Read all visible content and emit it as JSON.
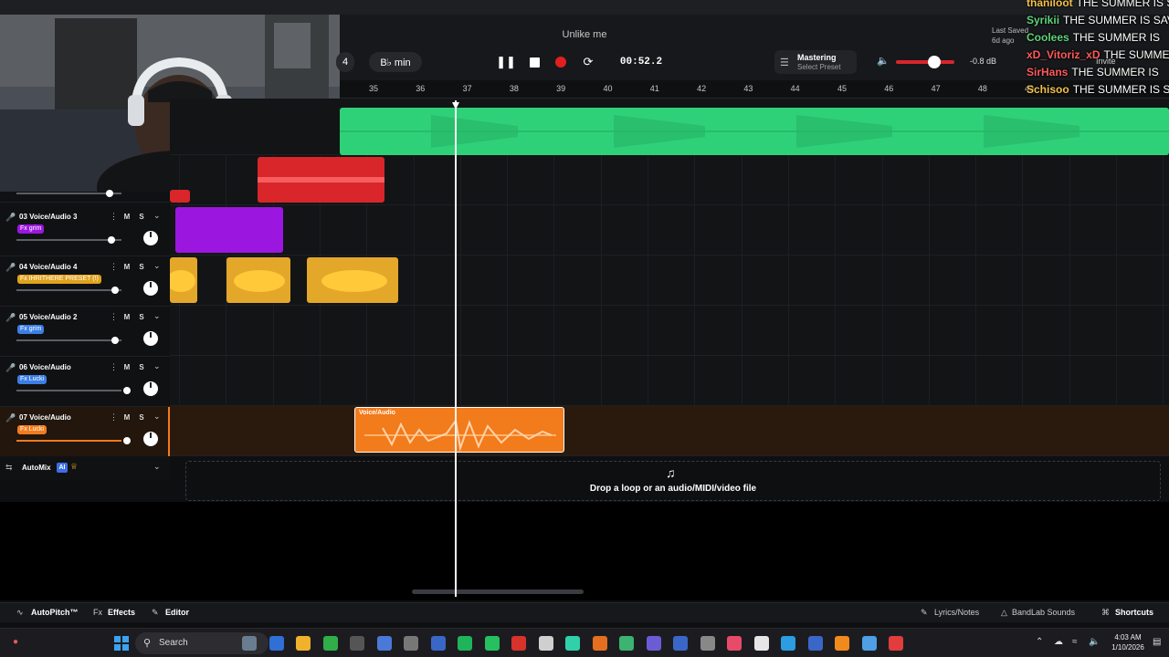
{
  "toolbar": {
    "song_title": "Unlike me",
    "tempo_fragment": "4",
    "key": "B♭ min",
    "time": "00:52.2",
    "mastering_label": "Mastering",
    "mastering_preset": "Select Preset",
    "volume_db": "-0.8 dB",
    "last_saved_label": "Last Saved",
    "last_saved_ago": "6d ago",
    "invite": "Invite"
  },
  "chat": [
    {
      "user": "thaniloot",
      "text": "THE SUMMER IS SAVED",
      "color": "#f2c14b"
    },
    {
      "user": "Syrikii",
      "text": "THE SUMMER IS SAVED",
      "color": "#5fd37a"
    },
    {
      "user": "Coolees",
      "text": "THE SUMMER IS",
      "color": "#5fd37a"
    },
    {
      "user": "xD_Vitoriz_xD",
      "text": "THE SUMMER IS DROPPED",
      "color": "#ff5a5a"
    },
    {
      "user": "SirHans",
      "text": "THE SUMMER IS",
      "color": "#ff5a5a"
    },
    {
      "user": "Schisoo",
      "text": "THE SUMMER IS S",
      "color": "#f2c14b"
    }
  ],
  "ruler": {
    "bars": [
      "35",
      "36",
      "37",
      "38",
      "39",
      "40",
      "41",
      "42",
      "43",
      "44",
      "45",
      "46",
      "47",
      "48",
      "49"
    ]
  },
  "tracks": [
    {
      "num_name": "03 Voice/Audio 3",
      "fx": "Fx grim",
      "fx_color": "#9b17e0",
      "volume": 0.9,
      "icon_color": "#9b17e0"
    },
    {
      "num_name": "04 Voice/Audio 4",
      "fx": "Fx IHRITHERE PRESET (!)",
      "fx_color": "#e0a21c",
      "volume": 0.94,
      "icon_color": "#e0a21c"
    },
    {
      "num_name": "05 Voice/Audio 2",
      "fx": "Fx grim",
      "fx_color": "#3b7ee6",
      "volume": 0.94,
      "icon_color": "#3b7ee6"
    },
    {
      "num_name": "06 Voice/Audio",
      "fx": "Fx Lucki",
      "fx_color": "#3b7ee6",
      "volume": 1.05,
      "icon_color": "#3b7ee6"
    },
    {
      "num_name": "07 Voice/Audio",
      "fx": "Fx Lucki",
      "fx_color": "#f27b1c",
      "volume": 1.05,
      "icon_color": "#f27b1c"
    }
  ],
  "track_controls": {
    "mute": "M",
    "solo": "S",
    "more": "⋮",
    "expand": "⌄"
  },
  "selected_clip_title": "Voice/Audio",
  "automix": {
    "label": "AutoMix",
    "ai_badge": "AI"
  },
  "dropzone": {
    "text": "Drop a loop or an audio/MIDI/video file"
  },
  "bottom_bar": {
    "autopitch": "AutoPitch™",
    "effects": "Effects",
    "editor": "Editor",
    "lyrics": "Lyrics/Notes",
    "sounds": "BandLab Sounds",
    "shortcuts": "Shortcuts"
  },
  "taskbar": {
    "search": "Search",
    "time": "4:03 AM",
    "date": "1/10/2026"
  },
  "colors": {
    "accent_green": "#2fd178",
    "red_clip": "#d8262b",
    "purple_clip": "#9b17e0",
    "yellow_clip": "#e3a72a",
    "orange_clip": "#f27b1c"
  }
}
